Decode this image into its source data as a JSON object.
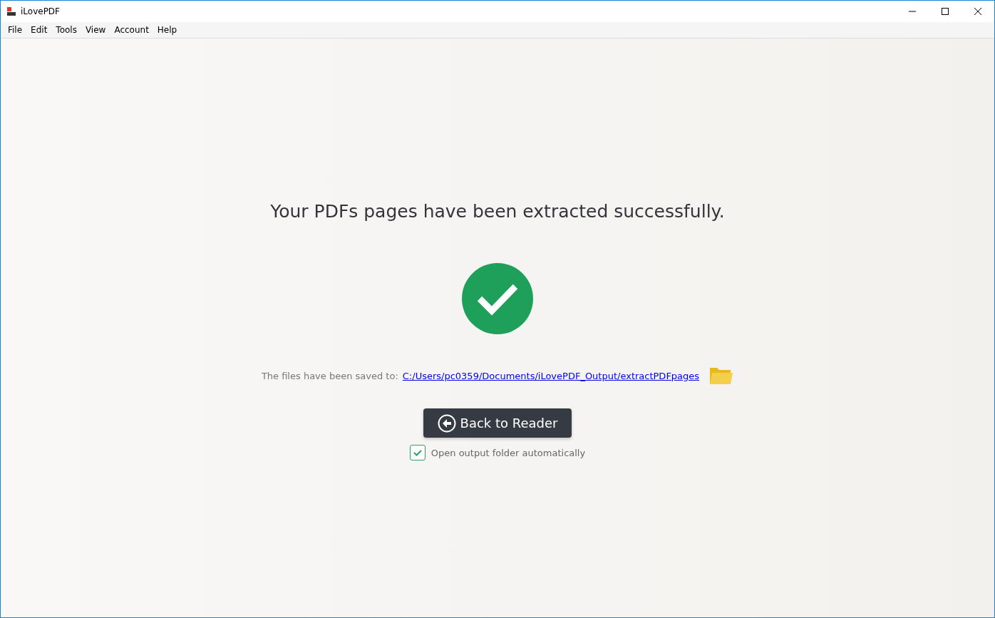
{
  "window": {
    "title": "iLovePDF"
  },
  "menu": [
    {
      "label": "File"
    },
    {
      "label": "Edit"
    },
    {
      "label": "Tools"
    },
    {
      "label": "View"
    },
    {
      "label": "Account"
    },
    {
      "label": "Help"
    }
  ],
  "message": "Your PDFs pages have been extracted successfully.",
  "saved": {
    "label": "The files have been saved to:",
    "path": "C:/Users/pc0359/Documents/iLovePDF_Output/extractPDFpages"
  },
  "back_button": "Back to Reader",
  "open_folder": {
    "label": "Open output folder automatically",
    "checked": true
  }
}
